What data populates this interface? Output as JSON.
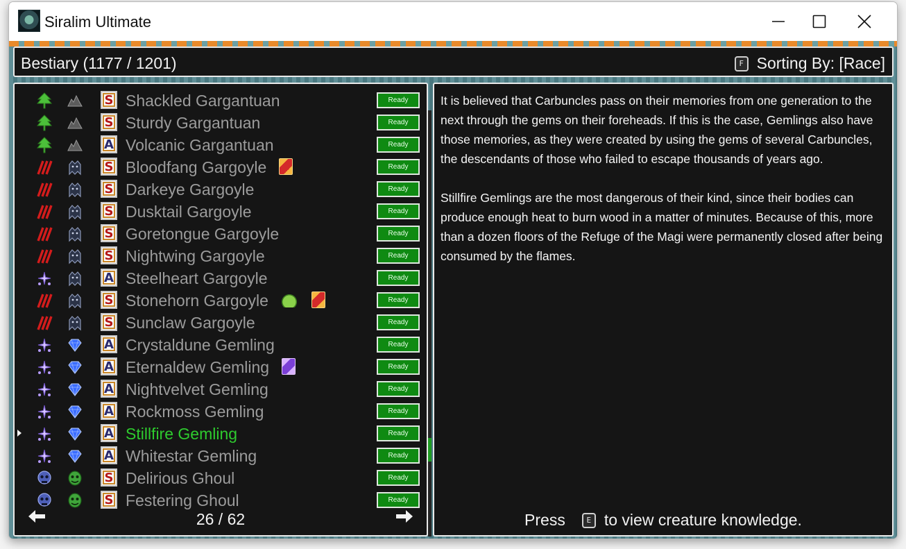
{
  "window": {
    "title": "Siralim Ultimate"
  },
  "header": {
    "title": "Bestiary (1177 / 1201)",
    "sort_key": "F",
    "sort_label": "Sorting By: [Race]"
  },
  "creatures": [
    {
      "name": "Shackled Gargantuan",
      "class_icon": "nature-tree-icon",
      "race_icon": "rock-pile-icon",
      "tier": "S",
      "status": "Ready",
      "extras": []
    },
    {
      "name": "Sturdy Gargantuan",
      "class_icon": "nature-tree-icon",
      "race_icon": "rock-pile-icon",
      "tier": "S",
      "status": "Ready",
      "extras": []
    },
    {
      "name": "Volcanic Gargantuan",
      "class_icon": "nature-tree-icon",
      "race_icon": "rock-pile-icon",
      "tier": "A",
      "status": "Ready",
      "extras": []
    },
    {
      "name": "Bloodfang Gargoyle",
      "class_icon": "chaos-claw-icon",
      "race_icon": "gargoyle-icon",
      "tier": "S",
      "status": "Ready",
      "extras": [
        "red-card-icon"
      ]
    },
    {
      "name": "Darkeye Gargoyle",
      "class_icon": "chaos-claw-icon",
      "race_icon": "gargoyle-icon",
      "tier": "S",
      "status": "Ready",
      "extras": []
    },
    {
      "name": "Dusktail Gargoyle",
      "class_icon": "chaos-claw-icon",
      "race_icon": "gargoyle-icon",
      "tier": "S",
      "status": "Ready",
      "extras": []
    },
    {
      "name": "Goretongue Gargoyle",
      "class_icon": "chaos-claw-icon",
      "race_icon": "gargoyle-icon",
      "tier": "S",
      "status": "Ready",
      "extras": []
    },
    {
      "name": "Nightwing Gargoyle",
      "class_icon": "chaos-claw-icon",
      "race_icon": "gargoyle-icon",
      "tier": "S",
      "status": "Ready",
      "extras": []
    },
    {
      "name": "Steelheart Gargoyle",
      "class_icon": "sorcery-sparkle-icon",
      "race_icon": "gargoyle-icon",
      "tier": "A",
      "status": "Ready",
      "extras": []
    },
    {
      "name": "Stonehorn Gargoyle",
      "class_icon": "chaos-claw-icon",
      "race_icon": "gargoyle-icon",
      "tier": "S",
      "status": "Ready",
      "extras": [
        "slime-icon",
        "red-card-icon"
      ]
    },
    {
      "name": "Sunclaw Gargoyle",
      "class_icon": "chaos-claw-icon",
      "race_icon": "gargoyle-icon",
      "tier": "S",
      "status": "Ready",
      "extras": []
    },
    {
      "name": "Crystaldune Gemling",
      "class_icon": "sorcery-sparkle-icon",
      "race_icon": "gem-icon",
      "tier": "A",
      "status": "Ready",
      "extras": []
    },
    {
      "name": "Eternaldew Gemling",
      "class_icon": "sorcery-sparkle-icon",
      "race_icon": "gem-icon",
      "tier": "A",
      "status": "Ready",
      "extras": [
        "purple-card-icon"
      ]
    },
    {
      "name": "Nightvelvet Gemling",
      "class_icon": "sorcery-sparkle-icon",
      "race_icon": "gem-icon",
      "tier": "A",
      "status": "Ready",
      "extras": []
    },
    {
      "name": "Rockmoss Gemling",
      "class_icon": "sorcery-sparkle-icon",
      "race_icon": "gem-icon",
      "tier": "A",
      "status": "Ready",
      "extras": []
    },
    {
      "name": "Stillfire Gemling",
      "class_icon": "sorcery-sparkle-icon",
      "race_icon": "gem-icon",
      "tier": "A",
      "status": "Ready",
      "extras": [],
      "selected": true
    },
    {
      "name": "Whitestar Gemling",
      "class_icon": "sorcery-sparkle-icon",
      "race_icon": "gem-icon",
      "tier": "A",
      "status": "Ready",
      "extras": []
    },
    {
      "name": "Delirious Ghoul",
      "class_icon": "death-skull-icon",
      "race_icon": "ghoul-icon",
      "tier": "S",
      "status": "Ready",
      "extras": []
    },
    {
      "name": "Festering Ghoul",
      "class_icon": "death-skull-icon",
      "race_icon": "ghoul-icon",
      "tier": "S",
      "status": "Ready",
      "extras": []
    }
  ],
  "pager": {
    "label": "26 / 62",
    "current_page": 26,
    "total_pages": 62
  },
  "description": {
    "paragraphs": [
      "It is believed that Carbuncles pass on their memories from one generation to the next through the gems on their foreheads. If this is the case, Gemlings also have those memories, as they were created by using the gems of several Carbuncles, the descendants of those who failed to escape thousands of years ago.",
      "Stillfire Gemlings are the most dangerous of their kind, since their bodies can produce enough heat to burn wood in a matter of minutes. Because of this, more than a dozen floors of the Refuge of the Magi were permanently closed after being consumed by the flames."
    ],
    "press_label": "Press",
    "press_key": "E",
    "press_suffix": "to view creature knowledge."
  },
  "colors": {
    "selected_name": "#2ecb2e",
    "name": "#9c9c9c",
    "ready_bg": "#0f8a12"
  }
}
